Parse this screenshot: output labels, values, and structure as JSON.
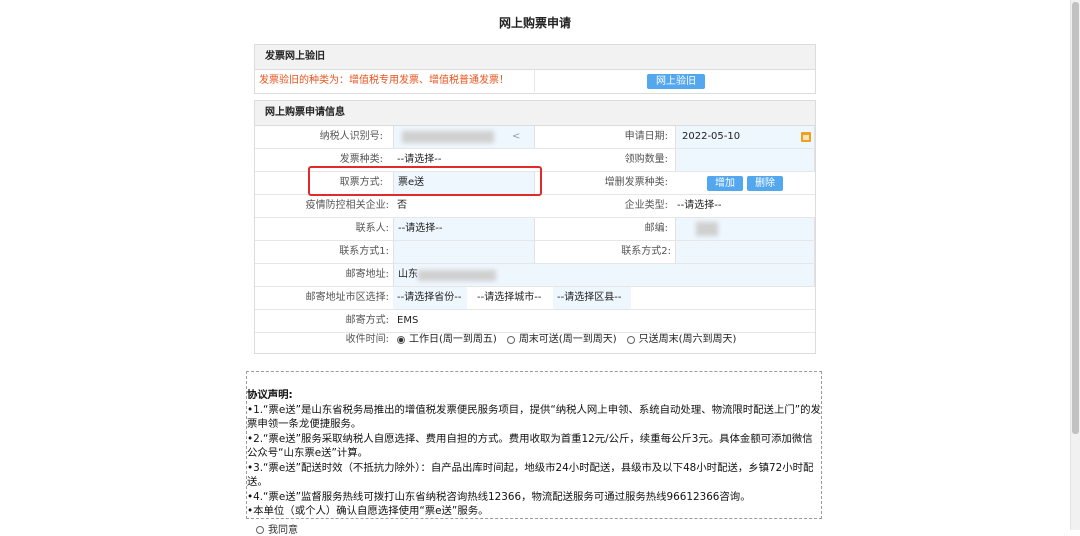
{
  "page_title": "网上购票申请",
  "verify_section": {
    "header": "发票网上验旧",
    "notice": "发票验旧的种类为：增值税专用发票、增值税普通发票！",
    "verify_button": "网上验旧"
  },
  "apply_section": {
    "header": "网上购票申请信息",
    "taxpayer_id_label": "纳税人识别号:",
    "taxpayer_id_tail": "<",
    "apply_date_label": "申请日期:",
    "apply_date_value": "2022-05-10",
    "invoice_type_label": "发票种类:",
    "invoice_type_value": "--请选择--",
    "receive_qty_label": "领购数量:",
    "pickup_method_label": "取票方式:",
    "pickup_method_value": "票e送",
    "add_del_type_label": "增删发票种类:",
    "add_button": "增加",
    "delete_button": "删除",
    "epidemic_label": "疫情防控相关企业:",
    "epidemic_value": "否",
    "company_type_label": "企业类型:",
    "company_type_value": "--请选择--",
    "contact_label": "联系人:",
    "contact_value": "--请选择--",
    "postcode_label": "邮编:",
    "phone1_label": "联系方式1:",
    "phone2_label": "联系方式2:",
    "address_label": "邮寄地址:",
    "address_value": "山东",
    "region_label": "邮寄地址市区选择:",
    "province_value": "--请选择省份--",
    "city_value": "--请选择城市--",
    "county_value": "--请选择区县--",
    "mail_method_label": "邮寄方式:",
    "mail_method_value": "EMS",
    "receive_time_label": "收件时间:",
    "receive_time_options": [
      "工作日(周一到周五)",
      "周末可送(周一到周天)",
      "只送周末(周六到周天)"
    ]
  },
  "agreement": {
    "title": "协议声明:",
    "items": [
      "•1.“票e送”是山东省税务局推出的增值税发票便民服务项目，提供“纳税人网上申领、系统自动处理、物流限时配送上门”的发票申领一条龙便捷服务。",
      "•2.“票e送”服务采取纳税人自愿选择、费用自担的方式。费用收取为首重12元/公斤，续重每公斤3元。具体金额可添加微信公众号“山东票e送”计算。",
      "•3.“票e送”配送时效（不抵抗力除外）：自产品出库时间起，地级市24小时配送，县级市及以下48小时配送，乡镇72小时配送。",
      "•4.“票e送”监督服务热线可拨打山东省纳税咨询热线12366，物流配送服务可通过服务热线96612366咨询。",
      "•本单位（或个人）确认自愿选择使用“票e送”服务。"
    ],
    "agree_option": "我同意"
  }
}
